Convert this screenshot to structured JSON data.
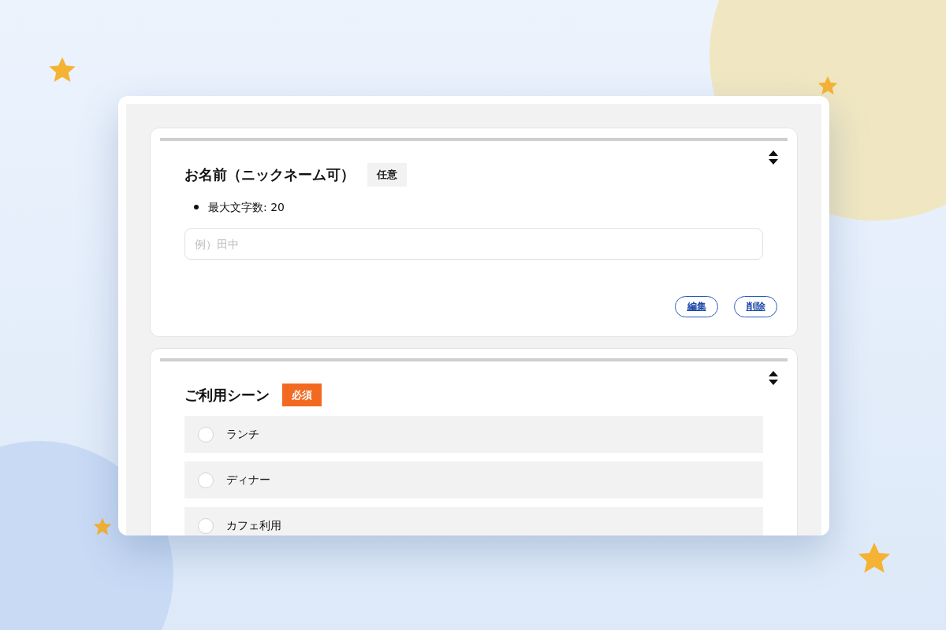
{
  "questions": [
    {
      "title": "お名前（ニックネーム可）",
      "badge": {
        "label": "任意",
        "kind": "optional"
      },
      "rules": [
        "最大文字数: 20"
      ],
      "input": {
        "placeholder": "例）田中"
      },
      "actions": [
        "編集",
        "削除"
      ]
    },
    {
      "title": "ご利用シーン",
      "badge": {
        "label": "必須",
        "kind": "required"
      },
      "options": [
        {
          "label": "ランチ",
          "selected": false
        },
        {
          "label": "ディナー",
          "selected": false
        },
        {
          "label": "カフェ利用",
          "selected": false
        }
      ]
    }
  ]
}
